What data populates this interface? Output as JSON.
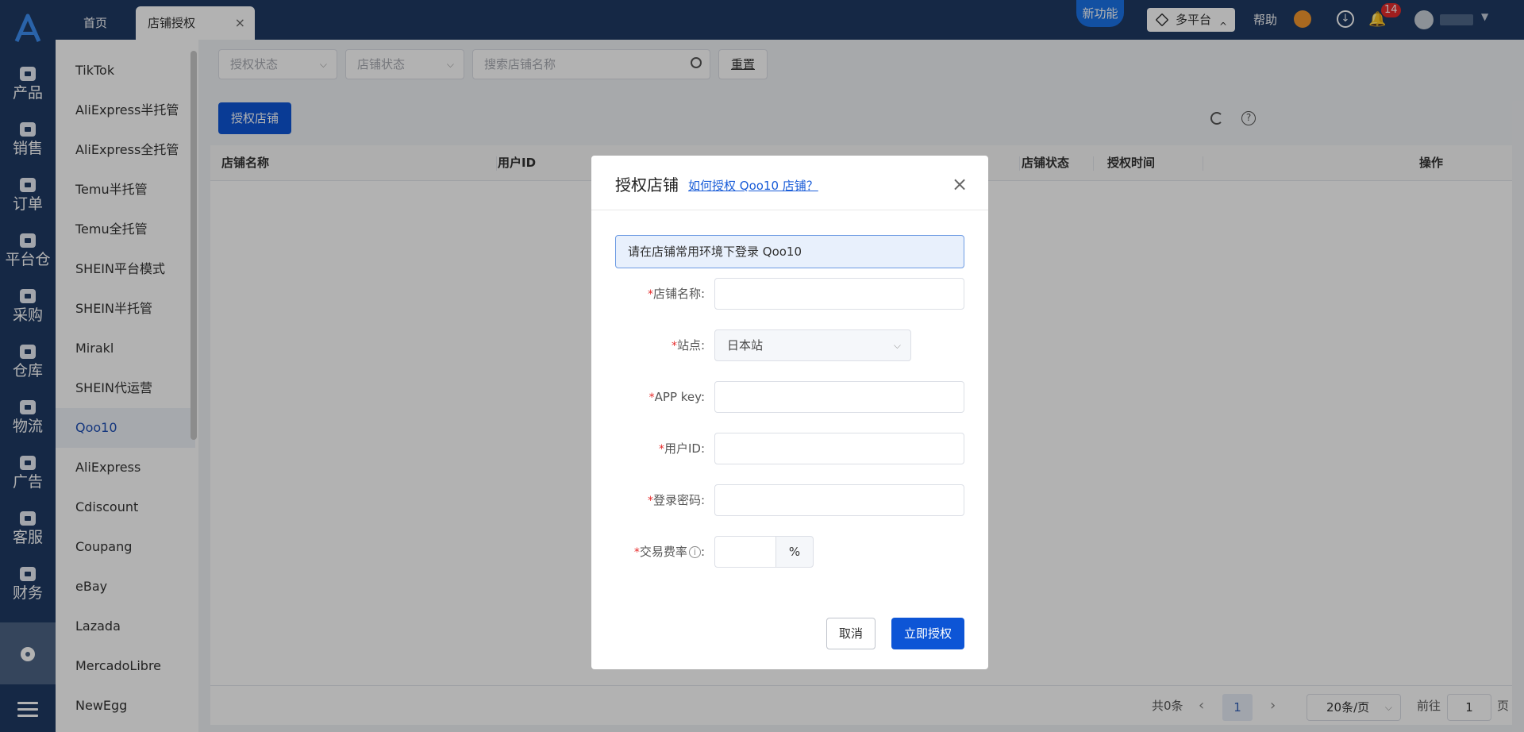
{
  "nav": {
    "items": [
      {
        "label": "产品",
        "icon": "bag-icon"
      },
      {
        "label": "销售",
        "icon": "sale-tag-icon"
      },
      {
        "label": "订单",
        "icon": "order-icon"
      },
      {
        "label": "平台仓",
        "icon": "warehouse-box-icon"
      },
      {
        "label": "采购",
        "icon": "cart-icon"
      },
      {
        "label": "仓库",
        "icon": "warehouse-icon"
      },
      {
        "label": "物流",
        "icon": "truck-icon"
      },
      {
        "label": "广告",
        "icon": "ad-icon"
      },
      {
        "label": "客服",
        "icon": "mail-icon"
      },
      {
        "label": "财务",
        "icon": "yen-icon"
      }
    ]
  },
  "tabs": {
    "home": "首页",
    "active": "店铺授权",
    "close": "×"
  },
  "header": {
    "new_feature": "新功能",
    "platform": "多平台",
    "help": "帮助",
    "notification_count": "14"
  },
  "sidebar": {
    "items": [
      "TikTok",
      "AliExpress半托管",
      "AliExpress全托管",
      "Temu半托管",
      "Temu全托管",
      "SHEIN平台模式",
      "SHEIN半托管",
      "Mirakl",
      "SHEIN代运营",
      "Qoo10",
      "AliExpress",
      "Cdiscount",
      "Coupang",
      "eBay",
      "Lazada",
      "MercadoLibre",
      "NewEgg"
    ],
    "active_index": 9
  },
  "filters": {
    "auth_status": "授权状态",
    "shop_status": "店铺状态",
    "search_placeholder": "搜索店铺名称",
    "reset": "重置"
  },
  "toolbar": {
    "authorize_button": "授权店铺"
  },
  "table": {
    "headers": [
      "店铺名称",
      "用户ID",
      "店铺状态",
      "授权时间",
      "操作"
    ]
  },
  "pagination": {
    "total": "共0条",
    "current_page": "1",
    "page_size": "20条/页",
    "goto_label": "前往",
    "goto_value": "1",
    "page_unit": "页"
  },
  "modal": {
    "title": "授权店铺",
    "help_link": "如何授权 Qoo10 店铺？",
    "close": "×",
    "notice": "请在店铺常用环境下登录 Qoo10",
    "fields": {
      "shop_name": "店铺名称:",
      "site": "站点:",
      "site_value": "日本站",
      "app_key": "APP key:",
      "user_id": "用户ID:",
      "password": "登录密码:",
      "fee_rate": "交易费率",
      "fee_rate_colon": ":",
      "fee_unit": "%"
    },
    "required_mark": "*",
    "cancel": "取消",
    "submit": "立即授权"
  },
  "colors": {
    "nav_bg": "#1f3a63",
    "primary": "#0d55d6",
    "required": "#e62b2b",
    "badge": "#e62b2b"
  }
}
